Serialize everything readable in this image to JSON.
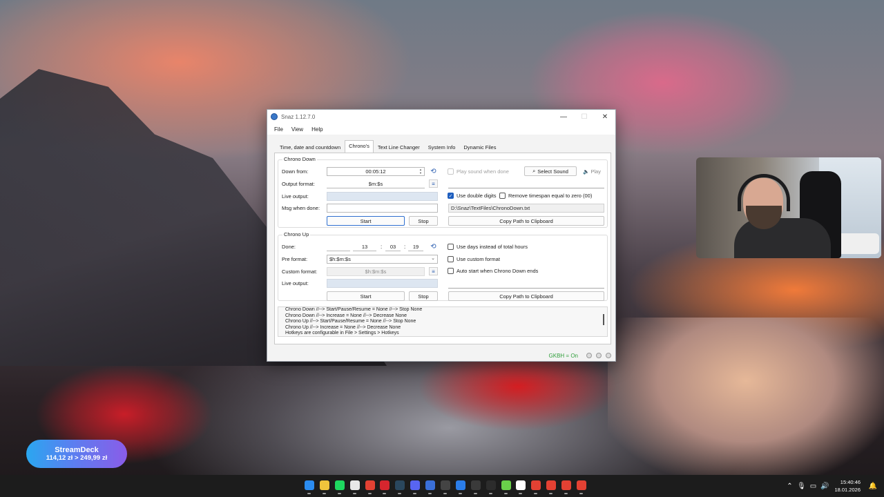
{
  "window": {
    "title": "Snaz 1.12.7.0",
    "minimize": "—",
    "maximize": "☐",
    "close": "✕"
  },
  "menu": [
    "File",
    "View",
    "Help"
  ],
  "tabs": [
    "Time, date and countdown",
    "Chrono's",
    "Text Line Changer",
    "System Info",
    "Dynamic Files"
  ],
  "active_tab": "Chrono's",
  "chrono_down": {
    "title": "Chrono Down",
    "down_from_label": "Down from:",
    "down_from_value": "00:05:12",
    "output_format_label": "Output format:",
    "output_format_value": "$m:$s",
    "live_output_label": "Live output:",
    "live_output_value": "",
    "msg_when_done_label": "Msg when done:",
    "msg_when_done_value": "",
    "start": "Start",
    "stop": "Stop",
    "play_sound_label": "Play sound when done",
    "select_sound": "Select Sound",
    "play": "Play",
    "use_double_digits_label": "Use double digits",
    "use_double_digits_checked": true,
    "remove_timespan_label": "Remove timespan equal to zero (00)",
    "remove_timespan_checked": false,
    "path": "D:\\Snaz\\TextFiles\\ChronoDown.txt",
    "copy_path": "Copy Path to Clipboard"
  },
  "chrono_up": {
    "title": "Chrono Up",
    "done_label": "Done:",
    "done_days": "",
    "done_h": "13",
    "done_m": "03",
    "done_s": "19",
    "sep": ":",
    "pre_format_label": "Pre format:",
    "pre_format_value": "$h:$m:$s",
    "custom_format_label": "Custom format:",
    "custom_format_value": "$h:$m:$s",
    "live_output_label": "Live output:",
    "start": "Start",
    "stop": "Stop",
    "use_days_label": "Use days instead of total hours",
    "use_custom_format_label": "Use custom format",
    "auto_start_label": "Auto start when Chrono Down ends",
    "copy_path": "Copy Path to Clipboard"
  },
  "hotkeys": [
    "Chrono Down //--> Start/Pause/Resume = None //--> Stop None",
    "Chrono Down //--> Increase = None //--> Decrease None",
    "Chrono Up //--> Start/Pause/Resume =  None //--> Stop None",
    "Chrono Up //--> Increase = None //--> Decrease None",
    "Hotkeys are configurable in File > Settings > Hotkeys"
  ],
  "status": {
    "gkbh": "GKBH = On"
  },
  "streamdeck": {
    "title": "StreamDeck",
    "price": "114,12 zł > 249,99 zł"
  },
  "taskbar": {
    "time": "15:40:46",
    "date": "18.01.2026",
    "icons": [
      {
        "name": "windows-start-icon",
        "color": "#2b8cf0"
      },
      {
        "name": "file-explorer-icon",
        "color": "#f0c43c"
      },
      {
        "name": "spotify-icon",
        "color": "#1ed760"
      },
      {
        "name": "app-icon-3",
        "color": "#e8e8e8"
      },
      {
        "name": "chrome-icon",
        "color": "#e34133"
      },
      {
        "name": "app-icon-5",
        "color": "#d6262e"
      },
      {
        "name": "steam-icon",
        "color": "#2a475e"
      },
      {
        "name": "discord-icon",
        "color": "#5865f2"
      },
      {
        "name": "app-icon-8",
        "color": "#3a6fd8"
      },
      {
        "name": "app-icon-9",
        "color": "#444444"
      },
      {
        "name": "app-icon-10",
        "color": "#2b7de9"
      },
      {
        "name": "obs-icon",
        "color": "#3a3a3a"
      },
      {
        "name": "app-icon-12",
        "color": "#2c2c2c"
      },
      {
        "name": "app-icon-13",
        "color": "#6ad04a"
      },
      {
        "name": "app-icon-14",
        "color": "#ffffff"
      },
      {
        "name": "chrome-icon-2",
        "color": "#e34133"
      },
      {
        "name": "chrome-icon-3",
        "color": "#e34133"
      },
      {
        "name": "chrome-icon-4",
        "color": "#e34133"
      },
      {
        "name": "chrome-icon-5",
        "color": "#e34133"
      }
    ]
  }
}
